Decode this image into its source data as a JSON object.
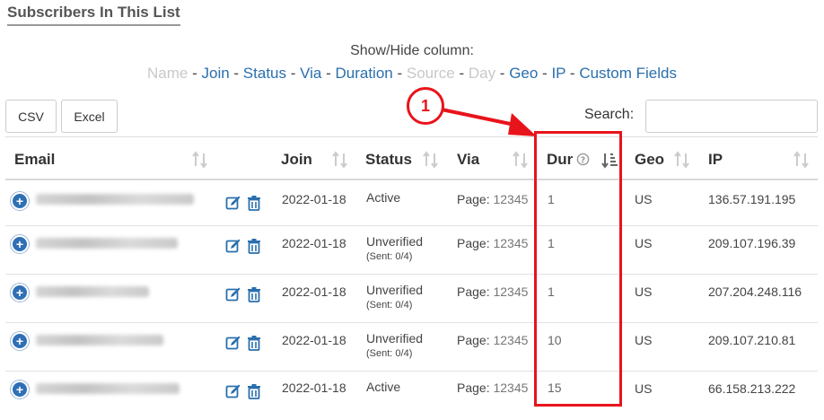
{
  "page_title": "Subscribers In This List",
  "column_toggle": {
    "label": "Show/Hide column:",
    "columns": [
      {
        "label": "Name",
        "visible": false
      },
      {
        "label": "Join",
        "visible": true
      },
      {
        "label": "Status",
        "visible": true
      },
      {
        "label": "Via",
        "visible": true
      },
      {
        "label": "Duration",
        "visible": true
      },
      {
        "label": "Source",
        "visible": false
      },
      {
        "label": "Day",
        "visible": false
      },
      {
        "label": "Geo",
        "visible": true
      },
      {
        "label": "IP",
        "visible": true
      },
      {
        "label": "Custom Fields",
        "visible": true
      }
    ],
    "separator": " - "
  },
  "export_buttons": {
    "csv": "CSV",
    "excel": "Excel"
  },
  "search": {
    "label": "Search:",
    "value": ""
  },
  "table": {
    "headers": {
      "email": "Email",
      "join": "Join",
      "status": "Status",
      "via": "Via",
      "dur": "Dur",
      "geo": "Geo",
      "ip": "IP"
    },
    "rows": [
      {
        "join": "2022-01-18",
        "status": "Active",
        "status_sub": "",
        "via_prefix": "Page:",
        "via_num": "12345",
        "dur": "1",
        "geo": "US",
        "ip": "136.57.191.195"
      },
      {
        "join": "2022-01-18",
        "status": "Unverified",
        "status_sub": "(Sent: 0/4)",
        "via_prefix": "Page:",
        "via_num": "12345",
        "dur": "1",
        "geo": "US",
        "ip": "209.107.196.39"
      },
      {
        "join": "2022-01-18",
        "status": "Unverified",
        "status_sub": "(Sent: 0/4)",
        "via_prefix": "Page:",
        "via_num": "12345",
        "dur": "1",
        "geo": "US",
        "ip": "207.204.248.116"
      },
      {
        "join": "2022-01-18",
        "status": "Unverified",
        "status_sub": "(Sent: 0/4)",
        "via_prefix": "Page:",
        "via_num": "12345",
        "dur": "10",
        "geo": "US",
        "ip": "209.107.210.81"
      },
      {
        "join": "2022-01-18",
        "status": "Active",
        "status_sub": "",
        "via_prefix": "Page:",
        "via_num": "12345",
        "dur": "15",
        "geo": "US",
        "ip": "66.158.213.222"
      }
    ]
  },
  "annotation": {
    "callout_number": "1",
    "color": "#e8141b"
  },
  "colors": {
    "link": "#2a6fad",
    "hidden_column": "#c8c8c8",
    "expand_button": "#2f6fb5",
    "action_icon": "#2a6fad"
  },
  "icons": {
    "expand": "plus-circle-icon",
    "edit": "edit-icon",
    "delete": "trash-icon",
    "sort": "sort-icon",
    "help": "question-circle-icon"
  }
}
